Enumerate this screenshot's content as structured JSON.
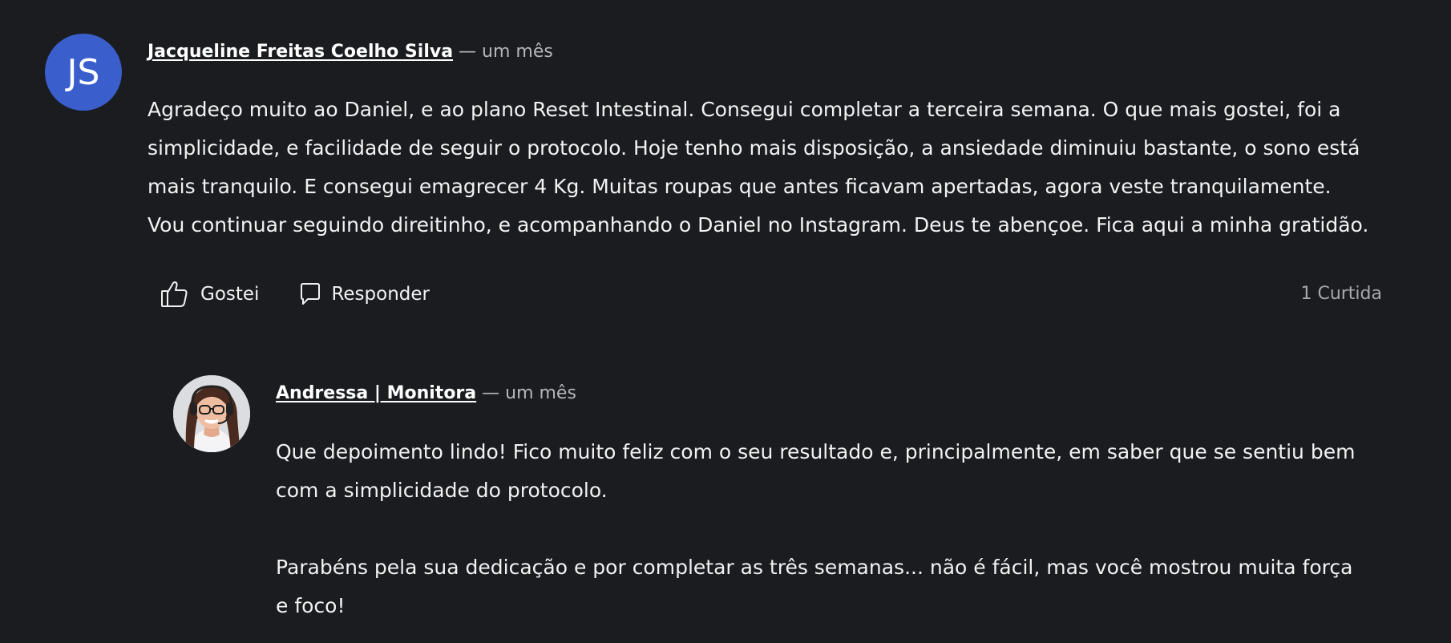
{
  "comment": {
    "avatar_initials": "JS",
    "author": "Jacqueline Freitas Coelho Silva",
    "time": "— um mês",
    "text": "Agradeço muito ao Daniel, e ao plano Reset Intestinal. Consegui completar a terceira semana. O que mais gostei, foi a simplicidade, e facilidade de seguir o protocolo. Hoje tenho mais disposição, a ansiedade diminuiu bastante, o sono está mais tranquilo. E consegui emagrecer 4 Kg. Muitas roupas que antes ficavam apertadas, agora veste tranquilamente. Vou continuar seguindo direitinho, e acompanhando o Daniel no Instagram. Deus te abençoe. Fica aqui a minha gratidão.",
    "like_label": "Gostei",
    "reply_label": "Responder",
    "likes_count": "1 Curtida"
  },
  "reply": {
    "author": "Andressa | Monitora",
    "time": "— um mês",
    "paragraphs": [
      "Que depoimento lindo! Fico muito feliz com o seu resultado e, principalmente, em saber que se sentiu bem com a simplicidade do protocolo.",
      "Parabéns pela sua dedicação e por completar as três semanas... não é fácil, mas você mostrou muita força e foco!"
    ]
  },
  "colors": {
    "background": "#1b1c20",
    "avatar": "#3a5fcd",
    "muted_text": "#b5b6bb"
  },
  "icons": {
    "like": "thumbs-up-icon",
    "reply": "speech-bubble-icon"
  }
}
